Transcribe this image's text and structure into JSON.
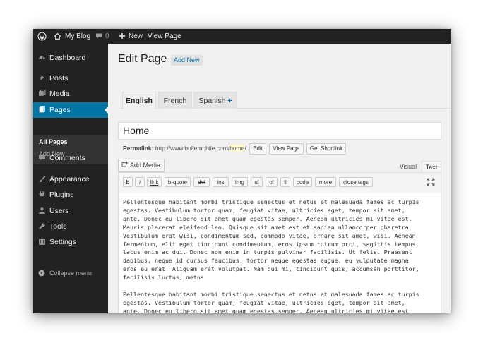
{
  "adminbar": {
    "site_name": "My Blog",
    "comments_count": "0",
    "new_label": "New",
    "view_page_label": "View Page"
  },
  "sidebar": {
    "items": [
      {
        "label": "Dashboard",
        "icon": "dashboard-icon"
      },
      {
        "label": "Posts",
        "icon": "pin-icon"
      },
      {
        "label": "Media",
        "icon": "media-icon"
      },
      {
        "label": "Pages",
        "icon": "pages-icon"
      },
      {
        "label": "Comments",
        "icon": "comment-icon"
      },
      {
        "label": "Appearance",
        "icon": "brush-icon"
      },
      {
        "label": "Plugins",
        "icon": "plugin-icon"
      },
      {
        "label": "Users",
        "icon": "users-icon"
      },
      {
        "label": "Tools",
        "icon": "wrench-icon"
      },
      {
        "label": "Settings",
        "icon": "settings-icon"
      }
    ],
    "submenu": [
      "All Pages",
      "Add New"
    ],
    "collapse_label": "Collapse menu"
  },
  "page": {
    "title": "Edit Page",
    "add_new_label": "Add New"
  },
  "tabs": [
    {
      "label": "English"
    },
    {
      "label": "French"
    },
    {
      "label": "Spanish"
    }
  ],
  "tab_plus": "+",
  "post_title": "Home",
  "permalink": {
    "label": "Permalink:",
    "base": "http://www.bullemobile.com/",
    "slug": "home",
    "trail": "/",
    "edit_label": "Edit",
    "view_label": "View Page",
    "shortlink_label": "Get Shortlink"
  },
  "editor": {
    "add_media_label": "Add Media",
    "visual_tab": "Visual",
    "text_tab": "Text",
    "quicktags": [
      "b",
      "i",
      "link",
      "b-quote",
      "del",
      "ins",
      "img",
      "ul",
      "ol",
      "li",
      "code",
      "more",
      "close tags"
    ],
    "paragraphs": [
      "Pellentesque habitant morbi tristique senectus et netus et malesuada fames ac turpis\negestas. Vestibulum tortor quam, feugiat vitae, ultricies eget, tempor sit amet,\nante. Donec eu libero sit amet quam egestas semper. Aenean ultricies mi vitae est.\nMauris placerat eleifend leo. Quisque sit amet est et sapien ullamcorper pharetra.\nVestibulum erat wisi, condimentum sed, commodo vitae, ornare sit amet, wisi. Aenean\nfermentum, elit eget tincidunt condimentum, eros ipsum rutrum orci, sagittis tempus\nlacus enim ac dui. Donec non enim in turpis pulvinar facilisis. Ut felis. Praesent\ndapibus, neque id cursus faucibus, tortor neque egestas augue, eu vulputate magna\neros eu erat. Aliquam erat volutpat. Nam dui mi, tincidunt quis, accumsan porttitor,\nfacilisis luctus, metus",
      "Pellentesque habitant morbi tristique senectus et netus et malesuada fames ac turpis\negestas. Vestibulum tortor quam, feugiat vitae, ultricies eget, tempor sit amet,\nante. Donec eu libero sit amet quam egestas semper. Aenean ultricies mi vitae est.\nMauris placerat eleifend leo. Quisque sit amet est et sapien ullamcorper pharetra."
    ]
  },
  "colors": {
    "admin_dark": "#222222",
    "accent": "#0074a2",
    "page_bg": "#f1f1f1"
  }
}
